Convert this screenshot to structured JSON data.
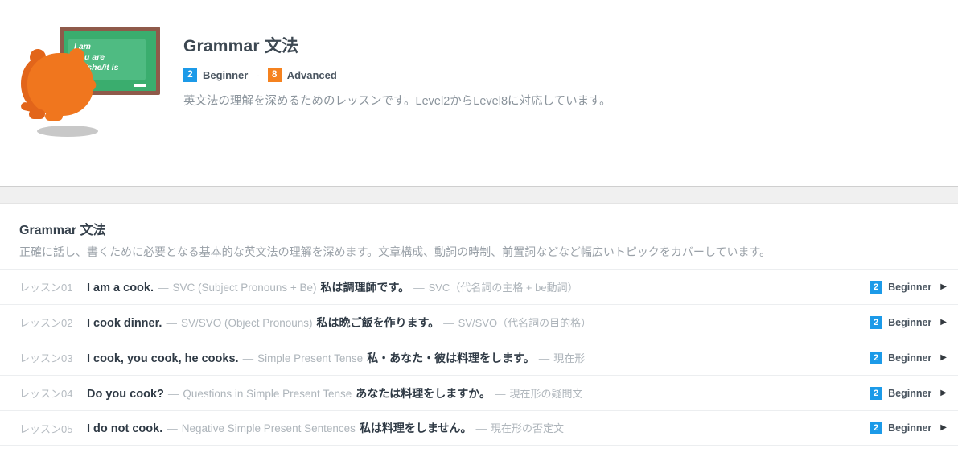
{
  "hero": {
    "title": "Grammar 文法",
    "levels": {
      "min_badge": "2",
      "min_label": "Beginner",
      "separator": "-",
      "max_badge": "8",
      "max_label": "Advanced",
      "min_color": "#1c9ae8",
      "max_color": "#f5821f"
    },
    "description": "英文法の理解を深めるためのレッスンです。Level2からLevel8に対応しています。",
    "illustration": {
      "board_line1": "I am",
      "board_line2": "You are",
      "board_line3": "He/she/it is",
      "board_color": "#3aad6e",
      "frame_color": "#8f5a4a",
      "character_color": "#f0761e"
    }
  },
  "section": {
    "title": "Grammar 文法",
    "description": "正確に話し、書くために必要となる基本的な英文法の理解を深めます。文章構成、動詞の時制、前置詞などなど幅広いトピックをカバーしています。"
  },
  "lessons": [
    {
      "number": "レッスン01",
      "english": "I am a cook.",
      "dash": "—",
      "subtitle_en": "SVC (Subject Pronouns + Be)",
      "japanese": "私は調理師です。",
      "dash2": "—",
      "subtitle_ja": "SVC（代名詞の主格 + be動詞）",
      "badge": "2",
      "level": "Beginner",
      "chevron": "▶"
    },
    {
      "number": "レッスン02",
      "english": "I cook dinner.",
      "dash": "—",
      "subtitle_en": "SV/SVO (Object Pronouns)",
      "japanese": "私は晩ご飯を作ります。",
      "dash2": "—",
      "subtitle_ja": "SV/SVO（代名詞の目的格）",
      "badge": "2",
      "level": "Beginner",
      "chevron": "▶"
    },
    {
      "number": "レッスン03",
      "english": "I cook, you cook, he cooks.",
      "dash": "—",
      "subtitle_en": "Simple Present Tense",
      "japanese": "私・あなた・彼は料理をします。",
      "dash2": "—",
      "subtitle_ja": "現在形",
      "badge": "2",
      "level": "Beginner",
      "chevron": "▶"
    },
    {
      "number": "レッスン04",
      "english": "Do you cook?",
      "dash": "—",
      "subtitle_en": "Questions in Simple Present Tense",
      "japanese": "あなたは料理をしますか。",
      "dash2": "—",
      "subtitle_ja": "現在形の疑問文",
      "badge": "2",
      "level": "Beginner",
      "chevron": "▶"
    },
    {
      "number": "レッスン05",
      "english": "I do not cook.",
      "dash": "—",
      "subtitle_en": "Negative Simple Present Sentences",
      "japanese": "私は料理をしません。",
      "dash2": "—",
      "subtitle_ja": "現在形の否定文",
      "badge": "2",
      "level": "Beginner",
      "chevron": "▶"
    }
  ]
}
